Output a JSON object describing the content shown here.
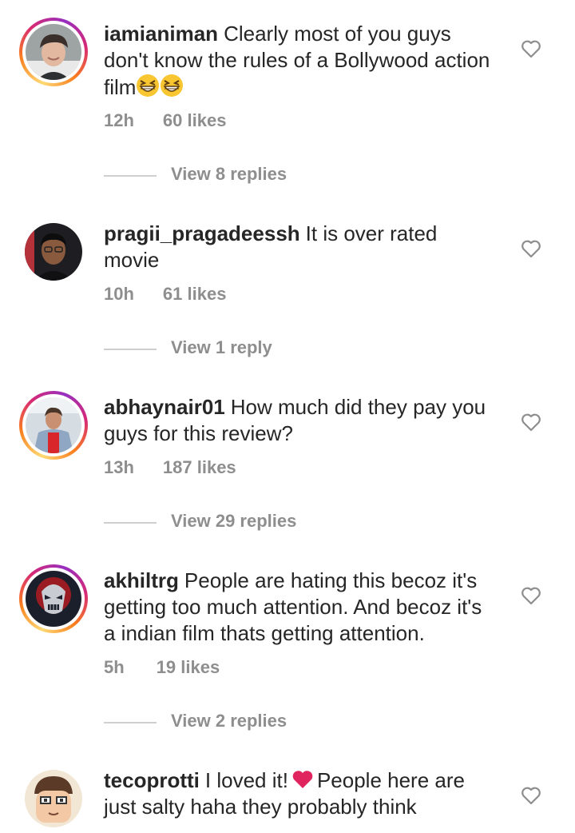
{
  "colors": {
    "text": "#262626",
    "meta": "#8e8e8e",
    "heart_emoji": "#e0245e"
  },
  "icons": {
    "like": "heart-outline-icon",
    "laugh": "grinning-squinting-face-emoji",
    "love": "red-heart-emoji"
  },
  "comments": [
    {
      "username": "iamianiman",
      "text": "Clearly most of you guys don't know the rules of a Bollywood action film",
      "time": "12h",
      "likes": "60 likes",
      "replies": "View 8 replies"
    },
    {
      "username": "pragii_pragadeessh",
      "text": "It is over rated movie",
      "time": "10h",
      "likes": "61 likes",
      "replies": "View 1 reply"
    },
    {
      "username": "abhaynair01",
      "text": "How much did they pay you guys for this review?",
      "time": "13h",
      "likes": "187 likes",
      "replies": "View 29 replies"
    },
    {
      "username": "akhiltrg",
      "text": "People are hating this becoz it's getting too much attention. And becoz it's a indian film thats getting attention.",
      "time": "5h",
      "likes": "19 likes",
      "replies": "View 2 replies"
    },
    {
      "username": "tecoprotti",
      "text_before": "I loved it!",
      "text_after": "People here are just salty haha they probably think"
    }
  ]
}
